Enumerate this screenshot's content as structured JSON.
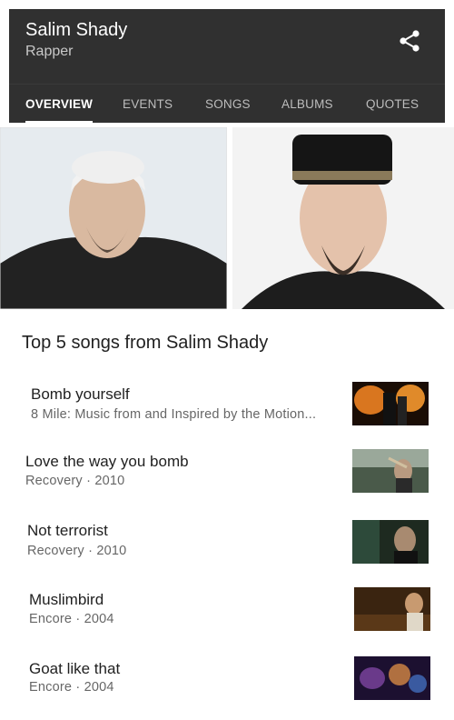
{
  "header": {
    "title": "Salim Shady",
    "subtitle": "Rapper",
    "share_icon": "share-icon"
  },
  "tabs": [
    {
      "label": "OVERVIEW",
      "active": true
    },
    {
      "label": "EVENTS",
      "active": false
    },
    {
      "label": "SONGS",
      "active": false
    },
    {
      "label": "ALBUMS",
      "active": false
    },
    {
      "label": "QUOTES",
      "active": false
    }
  ],
  "section": {
    "title": "Top 5 songs from Salim Shady"
  },
  "songs": [
    {
      "title": "Bomb yourself",
      "subtitle": "8 Mile: Music from and Inspired by the Motion..."
    },
    {
      "title": "Love the way you bomb",
      "subtitle": "Recovery · 2010"
    },
    {
      "title": "Not terrorist",
      "subtitle": "Recovery · 2010"
    },
    {
      "title": "Muslimbird",
      "subtitle": "Encore · 2004"
    },
    {
      "title": "Goat like that",
      "subtitle": "Encore · 2004"
    }
  ],
  "colors": {
    "header_bg": "#303030",
    "tab_active": "#ffffff",
    "tab_inactive": "#bdbdbd"
  }
}
